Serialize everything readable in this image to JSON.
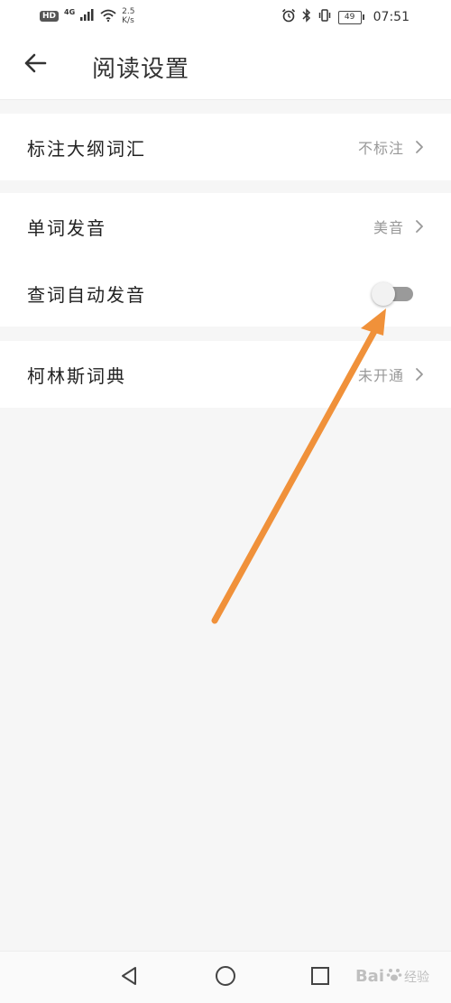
{
  "status_bar": {
    "hd": "HD",
    "network": "4G",
    "speed_value": "2.5",
    "speed_unit": "K/s",
    "battery": "49",
    "time": "07:51"
  },
  "header": {
    "title": "阅读设置",
    "back_icon": "arrow-left-icon"
  },
  "settings": {
    "syllabus_words": {
      "label": "标注大纲词汇",
      "value": "不标注"
    },
    "word_pronunciation": {
      "label": "单词发音",
      "value": "美音"
    },
    "auto_pronounce": {
      "label": "查词自动发音",
      "enabled": false
    },
    "collins_dictionary": {
      "label": "柯林斯词典",
      "value": "未开通"
    }
  },
  "nav_bar": {
    "back": "triangle-back-icon",
    "home": "circle-home-icon",
    "recents": "square-recents-icon"
  },
  "watermark": {
    "brand": "Bai",
    "suffix": "经验"
  },
  "colors": {
    "annotation_arrow": "#f0913a",
    "toggle_track_off": "#9a9a9a",
    "background": "#f6f6f6"
  }
}
